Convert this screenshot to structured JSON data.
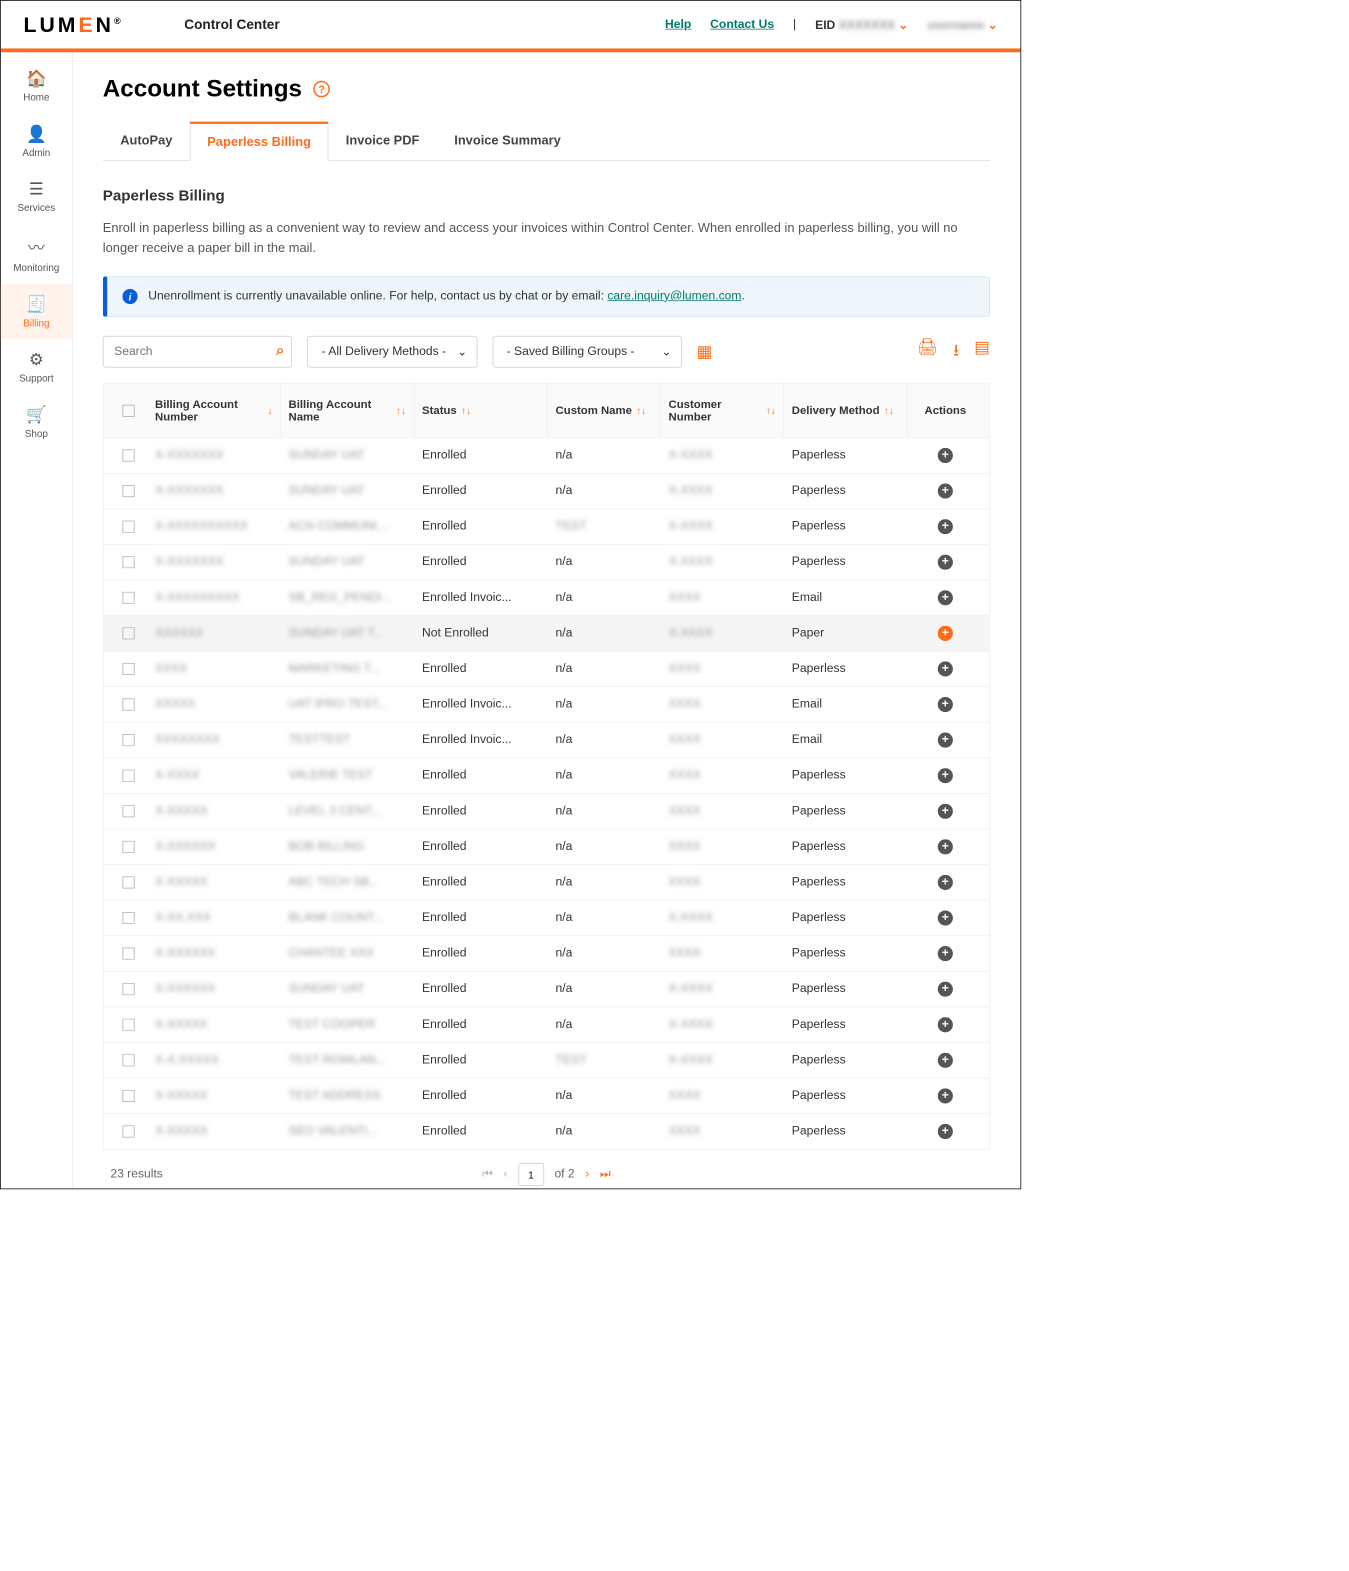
{
  "header": {
    "brand": "LUMEN",
    "product": "Control Center",
    "help": "Help",
    "contact": "Contact Us",
    "eid_label": "EID",
    "eid_value": "XXXXXXX",
    "user": "username"
  },
  "sidebar": {
    "items": [
      {
        "label": "Home",
        "icon": "🏠"
      },
      {
        "label": "Admin",
        "icon": "👤"
      },
      {
        "label": "Services",
        "icon": "☰"
      },
      {
        "label": "Monitoring",
        "icon": "〰"
      },
      {
        "label": "Billing",
        "icon": "🧾"
      },
      {
        "label": "Support",
        "icon": "⚙"
      },
      {
        "label": "Shop",
        "icon": "🛒"
      }
    ],
    "active_index": 4
  },
  "page": {
    "title": "Account Settings",
    "tabs": [
      "AutoPay",
      "Paperless Billing",
      "Invoice PDF",
      "Invoice Summary"
    ],
    "active_tab": 1,
    "section_title": "Paperless Billing",
    "section_desc": "Enroll in paperless billing as a convenient way to review and access your invoices within Control Center. When enrolled in paperless billing, you will no longer receive a paper bill in the mail.",
    "banner_text": "Unenrollment is currently unavailable online. For help, contact us by chat or by email: ",
    "banner_link": "care.inquiry@lumen.com",
    "search_placeholder": "Search",
    "delivery_filter": "- All Delivery Methods -",
    "billing_group_filter": "- Saved Billing Groups -"
  },
  "table": {
    "columns": [
      "Billing Account Number",
      "Billing Account Name",
      "Status",
      "Custom Name",
      "Customer Number",
      "Delivery Method",
      "Actions"
    ],
    "rows": [
      {
        "ban": "X-XXXXXXX",
        "name": "SUNDAY UAT",
        "status": "Enrolled",
        "custom": "n/a",
        "cust": "X-XXXX",
        "method": "Paperless",
        "hover": false,
        "orange": false
      },
      {
        "ban": "X-XXXXXXX",
        "name": "SUNDAY UAT",
        "status": "Enrolled",
        "custom": "n/a",
        "cust": "X-XXXX",
        "method": "Paperless",
        "hover": false,
        "orange": false
      },
      {
        "ban": "X-XXXXXXXXXX",
        "name": "ACN COMMUNI...",
        "status": "Enrolled",
        "custom": "TEST",
        "cust": "X-XXXX",
        "method": "Paperless",
        "hover": false,
        "orange": false
      },
      {
        "ban": "X-XXXXXXX",
        "name": "SUNDAY UAT",
        "status": "Enrolled",
        "custom": "n/a",
        "cust": "X-XXXX",
        "method": "Paperless",
        "hover": false,
        "orange": false
      },
      {
        "ban": "X-XXXXXXXXX",
        "name": "SB_REG_PENDI...",
        "status": "Enrolled Invoic...",
        "custom": "n/a",
        "cust": "XXXX",
        "method": "Email",
        "hover": false,
        "orange": false
      },
      {
        "ban": "XXXXXX",
        "name": "SUNDAY UAT T...",
        "status": "Not Enrolled",
        "custom": "n/a",
        "cust": "X-XXXX",
        "method": "Paper",
        "hover": true,
        "orange": true
      },
      {
        "ban": "XXXX",
        "name": "MARKETING T...",
        "status": "Enrolled",
        "custom": "n/a",
        "cust": "XXXX",
        "method": "Paperless",
        "hover": false,
        "orange": false
      },
      {
        "ban": "XXXXX",
        "name": "UAT IPRO TEST...",
        "status": "Enrolled Invoic...",
        "custom": "n/a",
        "cust": "XXXX",
        "method": "Email",
        "hover": false,
        "orange": false
      },
      {
        "ban": "XXXXXXXX",
        "name": "TESTTEST",
        "status": "Enrolled Invoic...",
        "custom": "n/a",
        "cust": "XXXX",
        "method": "Email",
        "hover": false,
        "orange": false
      },
      {
        "ban": "X-XXXX",
        "name": "VALERIE TEST",
        "status": "Enrolled",
        "custom": "n/a",
        "cust": "XXXX",
        "method": "Paperless",
        "hover": false,
        "orange": false
      },
      {
        "ban": "X-XXXXX",
        "name": "LEVEL 3 CENT...",
        "status": "Enrolled",
        "custom": "n/a",
        "cust": "XXXX",
        "method": "Paperless",
        "hover": false,
        "orange": false
      },
      {
        "ban": "X-XXXXXX",
        "name": "BOB BILLING",
        "status": "Enrolled",
        "custom": "n/a",
        "cust": "XXXX",
        "method": "Paperless",
        "hover": false,
        "orange": false
      },
      {
        "ban": "X-XXXXX",
        "name": "ABC TECH SB...",
        "status": "Enrolled",
        "custom": "n/a",
        "cust": "XXXX",
        "method": "Paperless",
        "hover": false,
        "orange": false
      },
      {
        "ban": "X-XX.XXX",
        "name": "BLANK COUNT...",
        "status": "Enrolled",
        "custom": "n/a",
        "cust": "X-XXXX",
        "method": "Paperless",
        "hover": false,
        "orange": false
      },
      {
        "ban": "X-XXXXXX",
        "name": "CHANTEE XXX",
        "status": "Enrolled",
        "custom": "n/a",
        "cust": "XXXX",
        "method": "Paperless",
        "hover": false,
        "orange": false
      },
      {
        "ban": "X-XXXXXX",
        "name": "SUNDAY UAT",
        "status": "Enrolled",
        "custom": "n/a",
        "cust": "X-XXXX",
        "method": "Paperless",
        "hover": false,
        "orange": false
      },
      {
        "ban": "X-XXXXX",
        "name": "TEST COOPER",
        "status": "Enrolled",
        "custom": "n/a",
        "cust": "X-XXXX",
        "method": "Paperless",
        "hover": false,
        "orange": false
      },
      {
        "ban": "X-X.XXXXX",
        "name": "TEST ROWLAN...",
        "status": "Enrolled",
        "custom": "TEST",
        "cust": "X-XXXX",
        "method": "Paperless",
        "hover": false,
        "orange": false
      },
      {
        "ban": "X-XXXXX",
        "name": "TEST ADDRESS",
        "status": "Enrolled",
        "custom": "n/a",
        "cust": "XXXX",
        "method": "Paperless",
        "hover": false,
        "orange": false
      },
      {
        "ban": "X-XXXXX",
        "name": "SEO VALENTI...",
        "status": "Enrolled",
        "custom": "n/a",
        "cust": "XXXX",
        "method": "Paperless",
        "hover": false,
        "orange": false
      }
    ],
    "results": "23 results",
    "current_page": "1",
    "page_text": "of  2"
  }
}
